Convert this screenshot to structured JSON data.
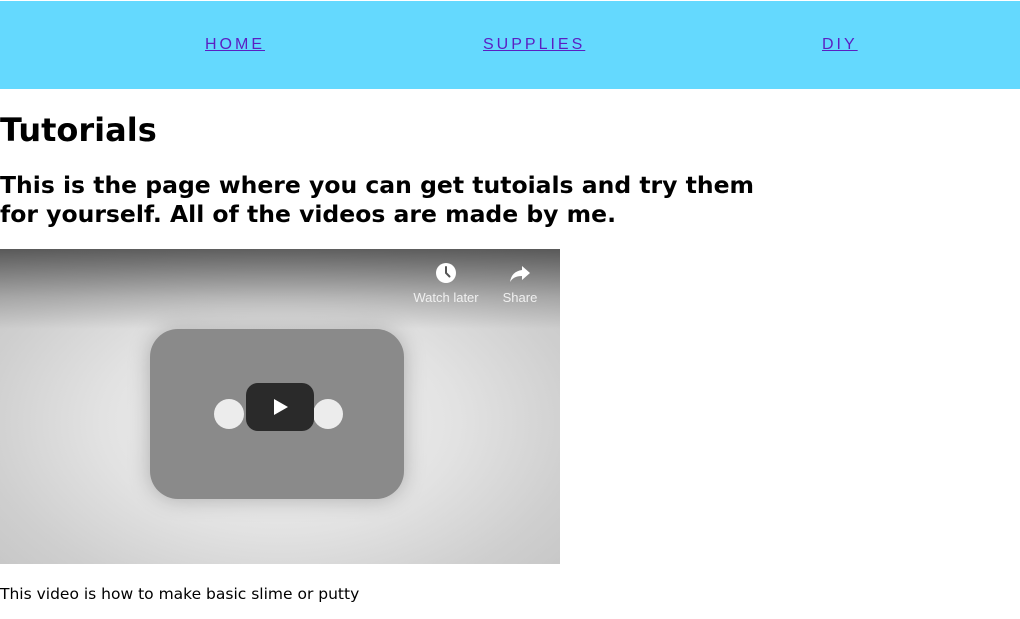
{
  "nav": {
    "home": "HOME",
    "supplies": "SUPPLIES",
    "diy": "DIY"
  },
  "main": {
    "title": "Tutorials",
    "intro": "This is the page where you can get tutoials and try them for yourself. All of the videos are made by me.",
    "video": {
      "watch_later_label": "Watch later",
      "share_label": "Share",
      "caption": "This video is how to make basic slime or putty"
    }
  },
  "colors": {
    "nav_background": "#64d9fe",
    "nav_link": "#5b1fc2",
    "play_button": "#2a2a2a"
  },
  "icons": [
    "play-icon",
    "clock-icon",
    "share-icon"
  ]
}
